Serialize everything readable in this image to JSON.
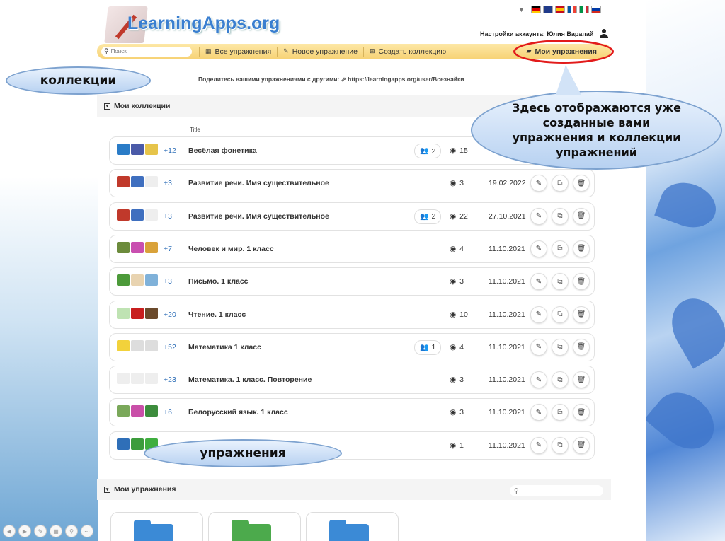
{
  "header": {
    "logo_text": "LearningApps.org",
    "account_label": "Настройки аккаунта: Юлия Варапай",
    "flags": [
      "de",
      "gb",
      "es",
      "fr",
      "it",
      "ru"
    ]
  },
  "navbar": {
    "search_placeholder": "Поиск",
    "all_exercises": "Все упражнения",
    "new_exercise": "Новое упражнение",
    "create_collection": "Создать коллекцию",
    "my_exercises": "Мои упражнения"
  },
  "share_text": "Поделитесь вашими упражнениями с другими: ⇗ https://learningapps.org/user/Всезнайки",
  "collections_section": {
    "title": "Мои коллекции",
    "column_title": "Title",
    "rows": [
      {
        "plus": "+12",
        "title": "Весёлая фонетика",
        "shared": "2",
        "views": "15",
        "date": "",
        "thumbs": [
          "#2a7cc7",
          "#4a5aa8",
          "#e6c44a"
        ]
      },
      {
        "plus": "+3",
        "title": "Развитие речи. Имя существительное",
        "shared": "",
        "views": "3",
        "date": "19.02.2022",
        "thumbs": [
          "#c0392b",
          "#3f6fbf",
          "#eeeeee"
        ]
      },
      {
        "plus": "+3",
        "title": "Развитие речи. Имя существительное",
        "shared": "2",
        "views": "22",
        "date": "27.10.2021",
        "thumbs": [
          "#c0392b",
          "#3f6fbf",
          "#eeeeee"
        ]
      },
      {
        "plus": "+7",
        "title": "Человек и мир. 1 класс",
        "shared": "",
        "views": "4",
        "date": "11.10.2021",
        "thumbs": [
          "#6c8b3c",
          "#c94fb0",
          "#d9a23a"
        ]
      },
      {
        "plus": "+3",
        "title": "Письмо. 1 класс",
        "shared": "",
        "views": "3",
        "date": "11.10.2021",
        "thumbs": [
          "#4c9a3a",
          "#e8d3b0",
          "#7fb1d9"
        ]
      },
      {
        "plus": "+20",
        "title": "Чтение. 1 класс",
        "shared": "",
        "views": "10",
        "date": "11.10.2021",
        "thumbs": [
          "#bfe3b3",
          "#c81e1e",
          "#6b4a2b"
        ]
      },
      {
        "plus": "+52",
        "title": "Математика 1 класс",
        "shared": "1",
        "views": "4",
        "date": "11.10.2021",
        "thumbs": [
          "#f2d23b",
          "#dddddd",
          "#dddddd"
        ]
      },
      {
        "plus": "+23",
        "title": "Математика. 1 класс. Повторение",
        "shared": "",
        "views": "3",
        "date": "11.10.2021",
        "thumbs": [
          "#eeeeee",
          "#eeeeee",
          "#eeeeee"
        ]
      },
      {
        "plus": "+6",
        "title": "Белорусский язык. 1 класс",
        "shared": "",
        "views": "3",
        "date": "11.10.2021",
        "thumbs": [
          "#7aa85a",
          "#c94fa8",
          "#3c8c3c"
        ]
      },
      {
        "plus": "",
        "title": "",
        "shared": "",
        "views": "1",
        "date": "11.10.2021",
        "thumbs": [
          "#2f6fb8",
          "#3c9c3c",
          "#3fae3f"
        ]
      }
    ]
  },
  "exercises_section": {
    "title": "Мои упражнения",
    "folders": [
      "#3b8ad6",
      "#4caa4c",
      "#3b8ad6"
    ]
  },
  "callouts": {
    "collections": "коллекции",
    "info": "Здесь отображаются уже созданные вами упражнения и коллекции упражнений",
    "exercises": "упражнения"
  },
  "colors": {
    "navbar": "#f7d376",
    "accent_blue": "#2f6fb8",
    "highlight_red": "#e21b1b"
  }
}
